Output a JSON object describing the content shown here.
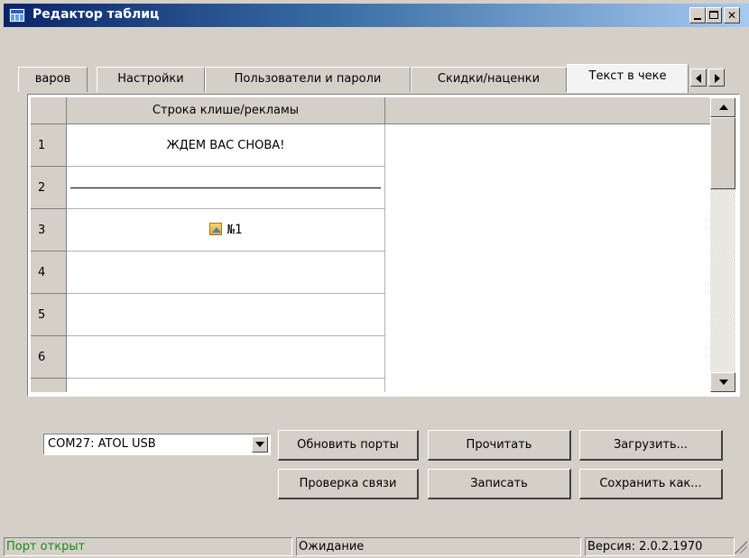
{
  "window": {
    "title": "Редактор таблиц"
  },
  "tabs": [
    {
      "label": "варов"
    },
    {
      "label": "Настройки"
    },
    {
      "label": "Пользователи и пароли"
    },
    {
      "label": "Скидки/наценки"
    },
    {
      "label": "Текст в чеке",
      "active": true
    }
  ],
  "grid": {
    "column_header": "Строка клише/рекламы",
    "rows": [
      {
        "num": "1",
        "text": "ЖДЕМ ВАС СНОВА!"
      },
      {
        "num": "2",
        "text": "",
        "rule": true
      },
      {
        "num": "3",
        "text": "№1",
        "image": true
      },
      {
        "num": "4",
        "text": ""
      },
      {
        "num": "5",
        "text": ""
      },
      {
        "num": "6",
        "text": ""
      },
      {
        "num": "",
        "text": ""
      }
    ]
  },
  "controls": {
    "port_select": "COM27: ATOL USB",
    "refresh_ports": "Обновить порты",
    "read": "Прочитать",
    "load": "Загрузить...",
    "check_connection": "Проверка связи",
    "write": "Записать",
    "save_as": "Сохранить как..."
  },
  "status": {
    "port": "Порт открыт",
    "state": "Ожидание",
    "version": "Версия: 2.0.2.1970"
  },
  "colors": {
    "status_ok": "#1a8a1a",
    "titlebar_start": "#0a246a",
    "titlebar_end": "#a6caf0"
  }
}
